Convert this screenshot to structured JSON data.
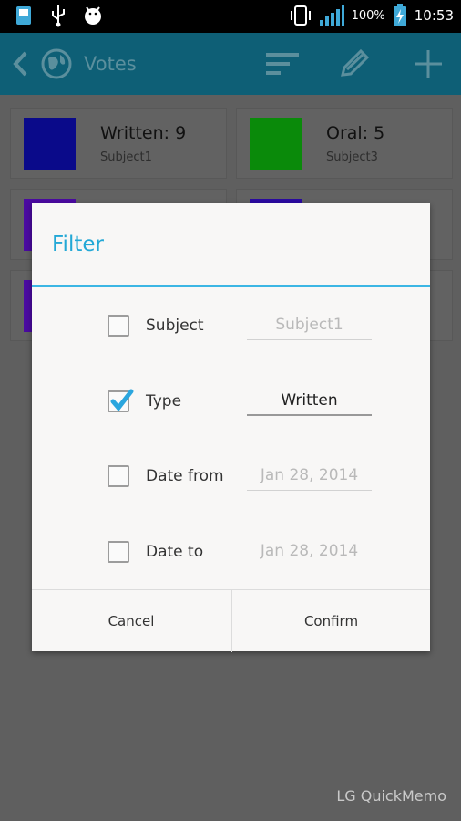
{
  "status_bar": {
    "battery_percent": "100%",
    "time": "10:53",
    "icons": [
      "sd-card-icon",
      "usb-icon",
      "android-debug-icon",
      "vibrate-icon",
      "signal-icon",
      "battery-charging-icon"
    ]
  },
  "action_bar": {
    "title": "Votes",
    "icons": [
      "back-icon",
      "globe-icon",
      "sort-icon",
      "edit-icon",
      "add-icon"
    ],
    "color": "#0e5f76"
  },
  "cards": [
    {
      "title": "Written: 9",
      "subtitle": "Subject1",
      "color": "#0a0a8a"
    },
    {
      "title": "Oral: 5",
      "subtitle": "Subject3",
      "color": "#0a8a0a"
    },
    {
      "title": "",
      "subtitle": "",
      "color": "#4a0aa0"
    },
    {
      "title": "",
      "subtitle": "",
      "color": "#2a0aa0"
    },
    {
      "title": "",
      "subtitle": "",
      "color": "#4a0aa0"
    },
    {
      "title": "",
      "subtitle": "",
      "color": "#5a5a5a"
    }
  ],
  "dialog": {
    "title": "Filter",
    "accent": "#23a8d6",
    "rows": [
      {
        "label": "Subject",
        "value": "Subject1",
        "checked": false
      },
      {
        "label": "Type",
        "value": "Written",
        "checked": true
      },
      {
        "label": "Date from",
        "value": "Jan 28, 2014",
        "checked": false
      },
      {
        "label": "Date to",
        "value": "Jan 28, 2014",
        "checked": false
      }
    ],
    "cancel_label": "Cancel",
    "confirm_label": "Confirm"
  },
  "watermark": "LG QuickMemo"
}
